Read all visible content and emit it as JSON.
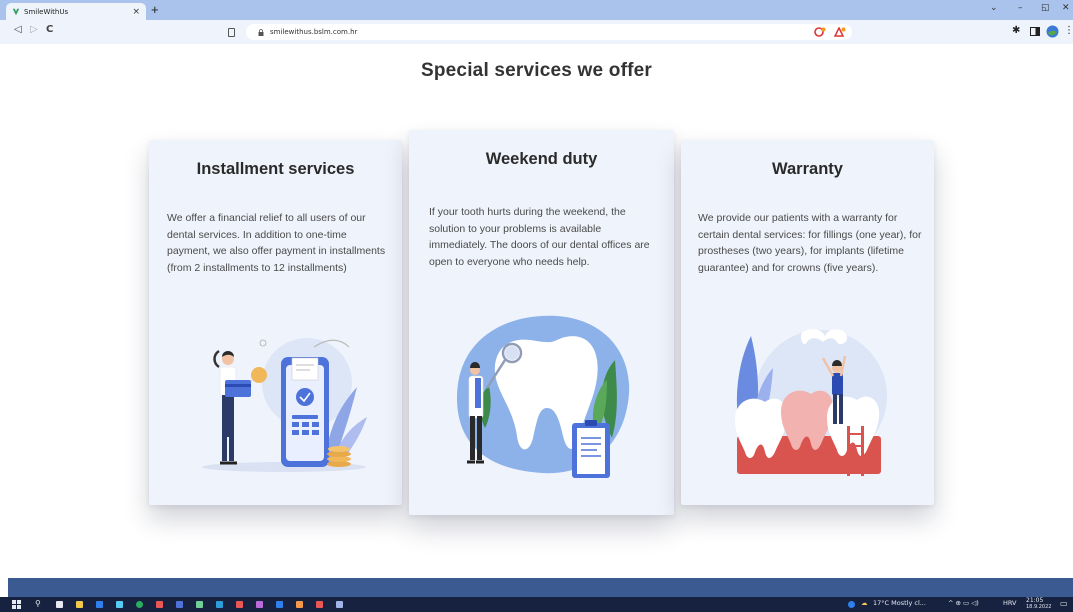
{
  "browser": {
    "tab_title": "SmileWithUs",
    "tab_close": "×",
    "new_tab": "+",
    "url": "smilewithus.bslm.com.hr",
    "nav": {
      "back": "◁",
      "forward": "▷",
      "reload": "C"
    },
    "window": {
      "chevron": "⌄",
      "minimize": "–",
      "restore": "◱",
      "close": "✕"
    }
  },
  "page": {
    "title": "Special services we offer",
    "cards": [
      {
        "title": "Installment services",
        "text": "We offer a financial relief to all users of our dental services. In addition to one-time payment, we also offer payment in installments (from 2 installments to 12 installments)",
        "illustration": "payment-terminal-illustration"
      },
      {
        "title": "Weekend duty",
        "text": "If your tooth hurts during the weekend, the solution to your problems is available immediately. The doors of our dental offices are open to everyone who needs help.",
        "illustration": "dentist-tooth-illustration"
      },
      {
        "title": "Warranty",
        "text": "We provide our patients with a warranty for certain dental services: for fillings (one year), for prostheses (two years), for implants (lifetime guarantee) and for crowns (five years).",
        "illustration": "teeth-cleaning-illustration"
      }
    ]
  },
  "taskbar": {
    "weather": "17°C  Mostly cl...",
    "tray_icons": "^ ⊕ ▭ ◁)",
    "language": "HRV",
    "time": "21:05",
    "date": "18.9.2022"
  },
  "colors": {
    "card_bg": "#eff3fb",
    "accent_blue": "#4d72d9",
    "footer_blue": "#3c5a92",
    "taskbar": "#16223f"
  }
}
